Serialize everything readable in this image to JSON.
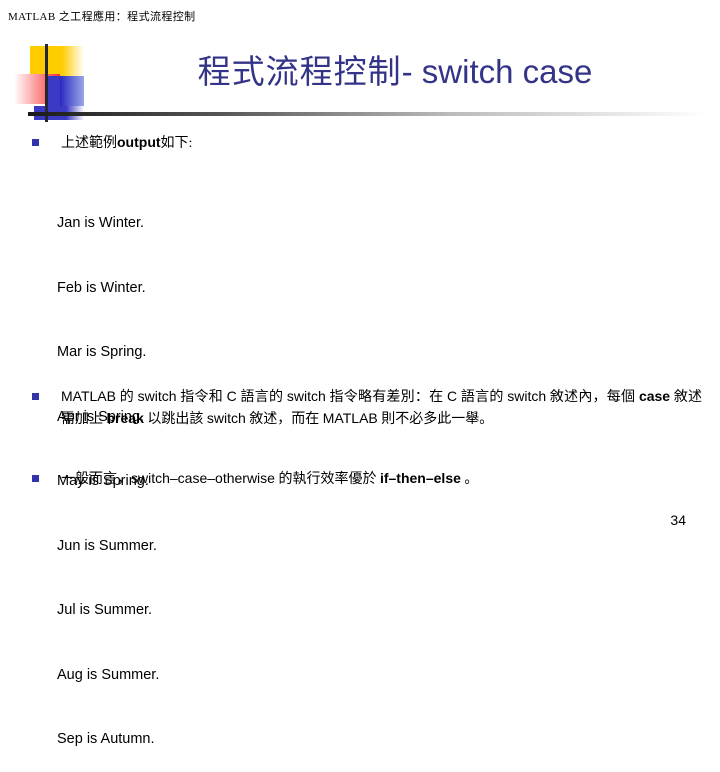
{
  "header": {
    "course_title": "MATLAB 之工程應用：程式流程控制"
  },
  "slide": {
    "title_cjk": "程式流程控制",
    "title_latin": "- switch case",
    "page_number": "34",
    "accent_color": "#333388",
    "bullet_color": "#3333aa"
  },
  "bullets": {
    "output_intro": {
      "label_cjk_1": "上述範例",
      "label_latin": "output",
      "label_cjk_2": "如下:"
    },
    "note": {
      "line1_a": "MATLAB",
      "line1_b": " 的 ",
      "line1_c": "switch",
      "line1_d": " 指令和 ",
      "line1_e": "C",
      "line1_f": " 語言的 ",
      "line1_g": "switch",
      "line1_h": " 指令略有差別：在 ",
      "line1_i": "C",
      "line1_j": " 語言的 ",
      "line1_k": "switch",
      "line2_a": " 敘述內，每個 ",
      "line2_b": "case",
      "line2_c": " 敘述需加上 ",
      "line2_d": "break",
      "line2_e": " 以跳出該 ",
      "line2_f": "switch",
      "line2_g": " 敘述，而在 ",
      "line2_h": "MATLAB",
      "line2_i": " 則不必多此一舉。"
    },
    "performance": {
      "seg1": "一般而言，",
      "seg2": "switch–case–otherwise",
      "seg3": " 的執行效率優於 ",
      "seg4": "if–then–else",
      "seg5": " 。"
    }
  },
  "console": {
    "lines": [
      "Jan is Winter.",
      "Feb is Winter.",
      "Mar is Spring.",
      "Apr is Spring.",
      "May is Spring.",
      "Jun is Summer.",
      "Jul is Summer.",
      "Aug is Summer.",
      "Sep is Autumn."
    ]
  }
}
